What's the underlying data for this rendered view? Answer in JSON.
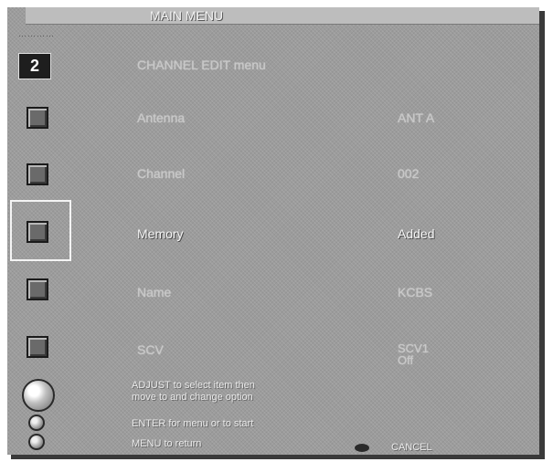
{
  "header": {
    "title": "MAIN MENU"
  },
  "channel": {
    "number": "2"
  },
  "submenu": {
    "title": "CHANNEL EDIT menu"
  },
  "items": [
    {
      "label": "Antenna",
      "value": "ANT A"
    },
    {
      "label": "Channel",
      "value": "002"
    },
    {
      "label": "Memory",
      "value": "Added"
    },
    {
      "label": "Name",
      "value": "KCBS"
    },
    {
      "label": "SCV",
      "value": "SCV1\nOff"
    }
  ],
  "hints": {
    "adjust": "ADJUST to select item then\nmove to and change option",
    "enter": "ENTER for menu or to start",
    "menu": "MENU to return",
    "cancel": "CANCEL"
  },
  "icons": [
    "channel-number",
    "antenna-square-icon",
    "channel-square-icon",
    "memory-square-icon",
    "name-square-icon",
    "scv-square-icon",
    "globe-icon",
    "enter-dot-icon",
    "menu-dot-icon",
    "cancel-button-icon"
  ]
}
